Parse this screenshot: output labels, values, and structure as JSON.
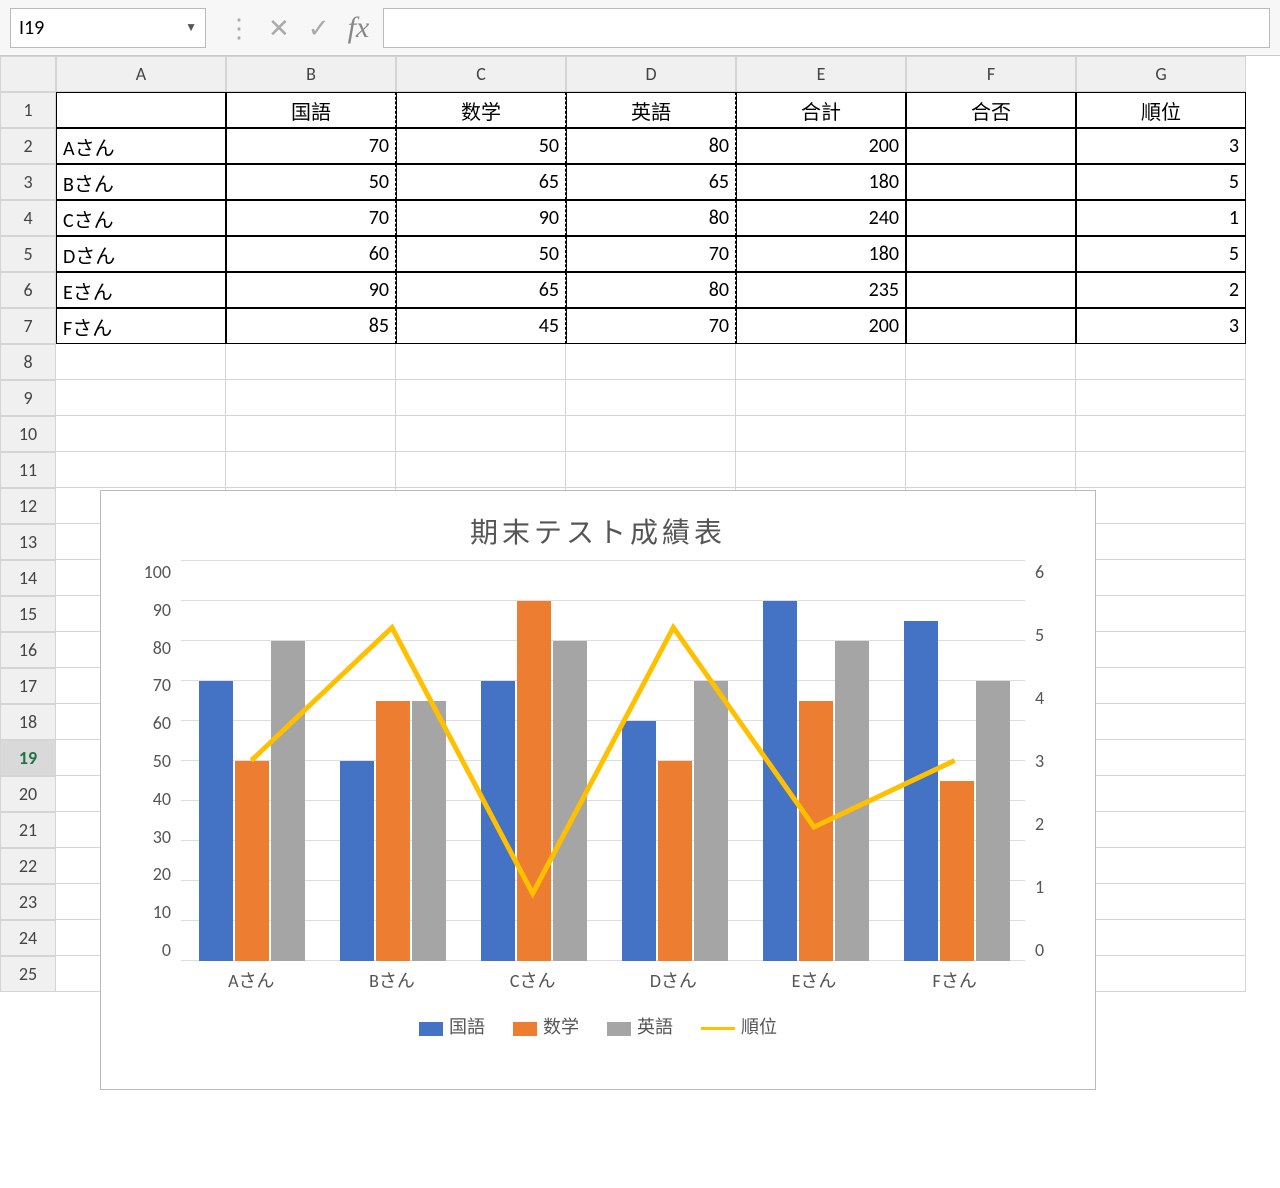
{
  "formula_bar": {
    "cell_ref": "I19",
    "formula": ""
  },
  "columns": [
    "A",
    "B",
    "C",
    "D",
    "E",
    "F",
    "G"
  ],
  "row_count": 25,
  "selected_row": 19,
  "table": {
    "headers": [
      "",
      "国語",
      "数学",
      "英語",
      "合計",
      "合否",
      "順位"
    ],
    "rows": [
      {
        "name": "Aさん",
        "kokugo": 70,
        "sugaku": 50,
        "eigo": 80,
        "gokei": 200,
        "gouhi": "",
        "juni": 3
      },
      {
        "name": "Bさん",
        "kokugo": 50,
        "sugaku": 65,
        "eigo": 65,
        "gokei": 180,
        "gouhi": "",
        "juni": 5
      },
      {
        "name": "Cさん",
        "kokugo": 70,
        "sugaku": 90,
        "eigo": 80,
        "gokei": 240,
        "gouhi": "",
        "juni": 1
      },
      {
        "name": "Dさん",
        "kokugo": 60,
        "sugaku": 50,
        "eigo": 70,
        "gokei": 180,
        "gouhi": "",
        "juni": 5
      },
      {
        "name": "Eさん",
        "kokugo": 90,
        "sugaku": 65,
        "eigo": 80,
        "gokei": 235,
        "gouhi": "",
        "juni": 2
      },
      {
        "name": "Fさん",
        "kokugo": 85,
        "sugaku": 45,
        "eigo": 70,
        "gokei": 200,
        "gouhi": "",
        "juni": 3
      }
    ]
  },
  "chart_data": {
    "type": "bar",
    "title": "期末テスト成績表",
    "categories": [
      "Aさん",
      "Bさん",
      "Cさん",
      "Dさん",
      "Eさん",
      "Fさん"
    ],
    "series": [
      {
        "name": "国語",
        "values": [
          70,
          50,
          70,
          60,
          90,
          85
        ],
        "color": "#4472C4",
        "type": "bar",
        "axis": "left"
      },
      {
        "name": "数学",
        "values": [
          50,
          65,
          90,
          50,
          65,
          45
        ],
        "color": "#ED7D31",
        "type": "bar",
        "axis": "left"
      },
      {
        "name": "英語",
        "values": [
          80,
          65,
          80,
          70,
          80,
          70
        ],
        "color": "#A5A5A5",
        "type": "bar",
        "axis": "left"
      },
      {
        "name": "順位",
        "values": [
          3,
          5,
          1,
          5,
          2,
          3
        ],
        "color": "#FFC000",
        "type": "line",
        "axis": "right"
      }
    ],
    "y_left": {
      "min": 0,
      "max": 100,
      "ticks": [
        0,
        10,
        20,
        30,
        40,
        50,
        60,
        70,
        80,
        90,
        100
      ]
    },
    "y_right": {
      "min": 0,
      "max": 6,
      "ticks": [
        0,
        1,
        2,
        3,
        4,
        5,
        6
      ]
    },
    "legend": [
      "国語",
      "数学",
      "英語",
      "順位"
    ]
  }
}
